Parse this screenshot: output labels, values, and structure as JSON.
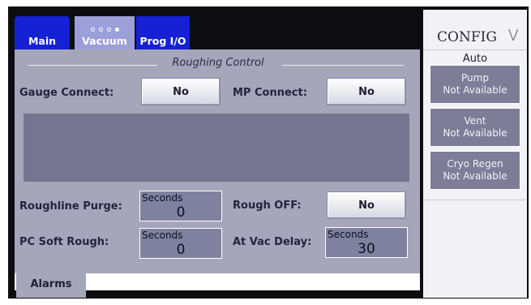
{
  "tabs": {
    "main": "Main",
    "vacuum": "Vacuum",
    "prog_io": "Prog I/O"
  },
  "section_title": "Roughing Control",
  "gauge_connect": {
    "label": "Gauge Connect:",
    "value": "No"
  },
  "mp_connect": {
    "label": "MP Connect:",
    "value": "No"
  },
  "roughline_purge": {
    "label": "Roughline Purge:",
    "unit": "Seconds",
    "value": "0"
  },
  "rough_off": {
    "label": "Rough OFF:",
    "value": "No"
  },
  "pc_soft_rough": {
    "label": "PC Soft Rough:",
    "unit": "Seconds",
    "value": "0"
  },
  "at_vac_delay": {
    "label": "At Vac Delay:",
    "unit": "Seconds",
    "value": "30"
  },
  "alarms": "Alarms",
  "side": {
    "config": "CONFIG",
    "mode": "Auto",
    "items": [
      {
        "title": "Pump",
        "status": "Not Available"
      },
      {
        "title": "Vent",
        "status": "Not Available"
      },
      {
        "title": "Cryo Regen",
        "status": "Not Available"
      }
    ]
  },
  "icons": {
    "config_toggle": "chevron-down-icon"
  },
  "colors": {
    "tab_active": "#1521d2",
    "panel": "#a6a6ba",
    "field": "#8080a0"
  }
}
